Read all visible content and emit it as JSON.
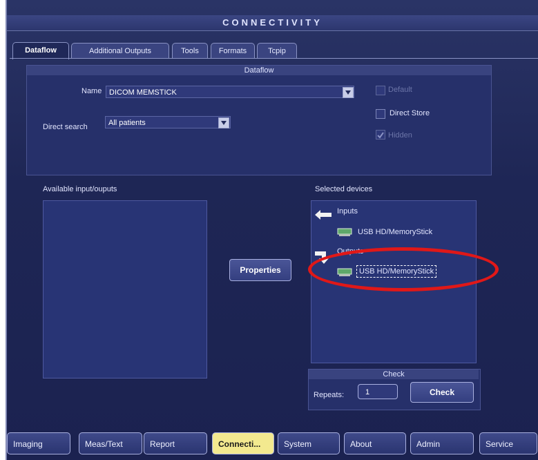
{
  "window": {
    "title": "CONNECTIVITY"
  },
  "tabs": [
    {
      "label": "Dataflow",
      "active": true
    },
    {
      "label": "Additional Outputs",
      "active": false
    },
    {
      "label": "Tools",
      "active": false
    },
    {
      "label": "Formats",
      "active": false
    },
    {
      "label": "Tcpip",
      "active": false
    }
  ],
  "dataflow": {
    "title": "Dataflow",
    "name_label": "Name",
    "name_value": "DICOM MEMSTICK",
    "direct_search_label": "Direct search",
    "direct_search_value": "All patients",
    "checkboxes": {
      "default": {
        "label": "Default",
        "checked": false,
        "enabled": false
      },
      "direct_store": {
        "label": "Direct Store",
        "checked": false,
        "enabled": true
      },
      "hidden": {
        "label": "Hidden",
        "checked": true,
        "enabled": false
      }
    }
  },
  "available": {
    "label": "Available input/ouputs"
  },
  "properties_button": "Properties",
  "selected": {
    "label": "Selected devices",
    "inputs_label": "Inputs",
    "input_device": "USB HD/MemoryStick",
    "outputs_label": "Outputs",
    "output_device": "USB HD/MemoryStick"
  },
  "check": {
    "title": "Check",
    "repeats_label": "Repeats:",
    "repeats_value": "1",
    "button": "Check"
  },
  "nav": [
    {
      "label": "Imaging",
      "active": false
    },
    {
      "label": "Meas/Text",
      "active": false
    },
    {
      "label": "Report",
      "active": false
    },
    {
      "label": "Connecti...",
      "active": true
    },
    {
      "label": "System",
      "active": false
    },
    {
      "label": "About",
      "active": false
    },
    {
      "label": "Admin",
      "active": false
    },
    {
      "label": "Service",
      "active": false
    }
  ],
  "colors": {
    "highlight_ellipse": "#e01818",
    "active_nav": "#f3e98f"
  }
}
